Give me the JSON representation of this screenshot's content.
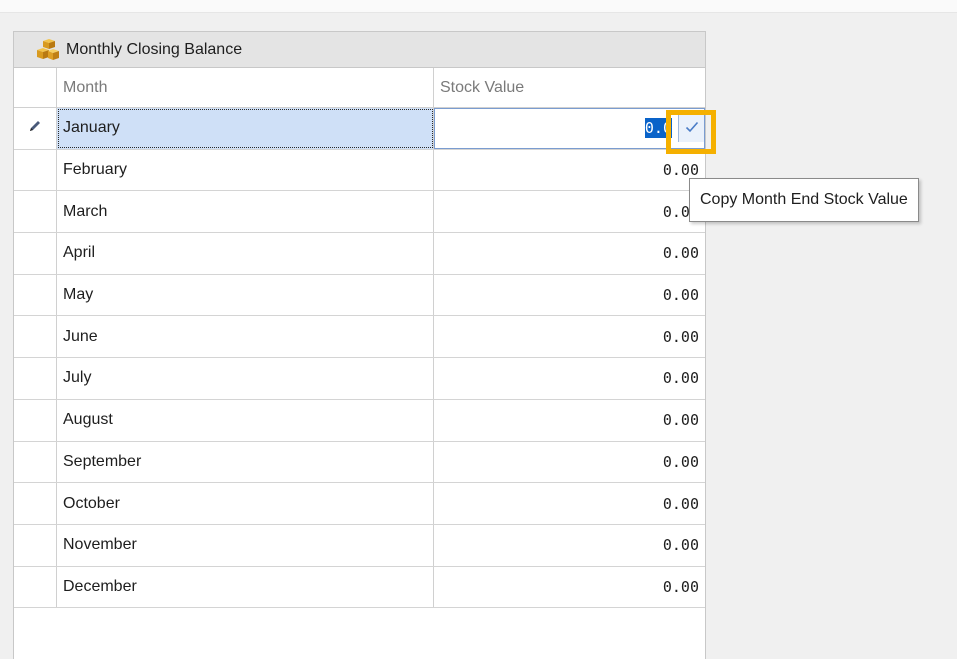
{
  "panel": {
    "title": "Monthly Closing Balance",
    "icon": "boxes-icon"
  },
  "grid": {
    "columns": [
      "Month",
      "Stock Value"
    ],
    "rows": [
      {
        "month": "January",
        "value": "0.00"
      },
      {
        "month": "February",
        "value": "0.00"
      },
      {
        "month": "March",
        "value": "0.00"
      },
      {
        "month": "April",
        "value": "0.00"
      },
      {
        "month": "May",
        "value": "0.00"
      },
      {
        "month": "June",
        "value": "0.00"
      },
      {
        "month": "July",
        "value": "0.00"
      },
      {
        "month": "August",
        "value": "0.00"
      },
      {
        "month": "September",
        "value": "0.00"
      },
      {
        "month": "October",
        "value": "0.00"
      },
      {
        "month": "November",
        "value": "0.00"
      },
      {
        "month": "December",
        "value": "0.00"
      }
    ],
    "active_row_index": 0,
    "editor": {
      "value": "0.00",
      "visible_text": "0.0"
    }
  },
  "tooltip": {
    "text": "Copy Month End Stock Value"
  },
  "colors": {
    "selection": "#0a63c9",
    "active_row": "#cfe0f7",
    "highlight": "#f5b000",
    "check": "#4a7cc7"
  }
}
